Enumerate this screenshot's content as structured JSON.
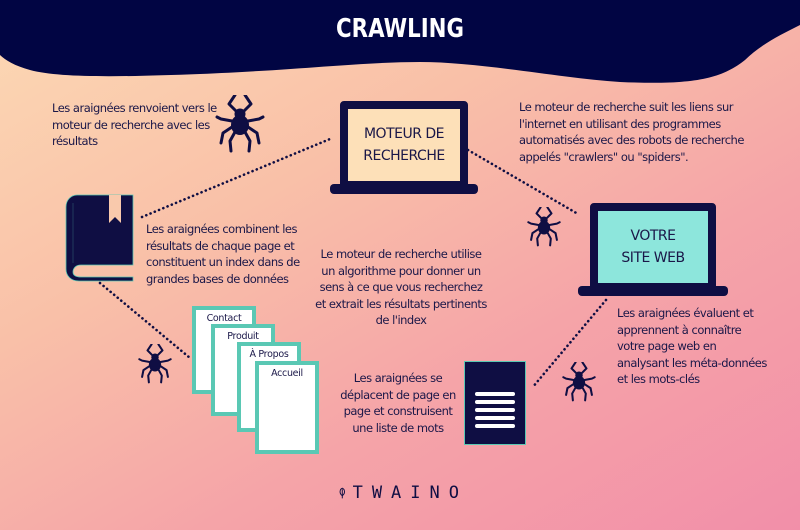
{
  "header": {
    "title": "CRAWLING",
    "background_color": "#010543"
  },
  "nodes": {
    "search_engine": {
      "label": "MOTEUR DE\nRECHERCHE",
      "screen_color": "#fde0b8"
    },
    "website": {
      "label": "VOTRE\nSITE WEB",
      "screen_color": "#8de6dc"
    },
    "pages": [
      {
        "label": "Contact"
      },
      {
        "label": "Produit"
      },
      {
        "label": "À Propos"
      },
      {
        "label": "Accueil"
      }
    ]
  },
  "descriptions": {
    "return_results": "Les araignées renvoient vers le moteur de recherche avec les résultats",
    "follow_links": "Le moteur de recherche suit les liens sur l'internet en utilisant des programmes automatisés avec des robots de recherche appelés \"crawlers\" ou \"spiders\".",
    "build_index": "Les araignées combinent les résultats de chaque page et constituent un index dans de grandes bases de données",
    "algorithm": "Le moteur de recherche utilise un algorithme pour donner un sens à ce que vous recherchez et extrait les résultats pertinents de l'index",
    "evaluate_site": "Les araignées évaluent et apprennent à connaître votre page web en analysant les méta-données et les mots-clés",
    "word_list": "Les araignées se déplacent de page en page et construisent une liste de mots"
  },
  "icons": {
    "spider": "spider-icon",
    "book": "book-icon",
    "document": "document-list-icon",
    "logo_leaf": "leaf-icon"
  },
  "colors": {
    "navy": "#0f0e43",
    "teal": "#5ac8b4",
    "peach": "#fcd9b4",
    "pink": "#f28fa9"
  },
  "brand": {
    "name": "TWAINO"
  }
}
